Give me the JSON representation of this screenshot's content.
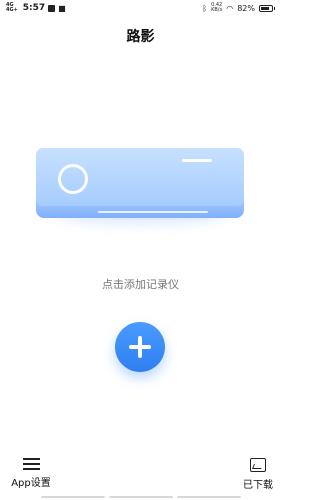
{
  "status_bar": {
    "network_top": "4G",
    "network_bottom": "4G+",
    "time": "5:57",
    "speed_value": "0.42",
    "speed_unit": "KB/s",
    "battery_percent": "82%",
    "battery_level": 0.82
  },
  "header": {
    "title": "路影"
  },
  "main": {
    "illustration_icon": "air-conditioner-icon",
    "hint": "点击添加记录仪",
    "add_button_icon": "plus-icon"
  },
  "bottom_nav": {
    "left_label": "App设置",
    "left_icon": "menu-icon",
    "right_label": "已下载",
    "right_icon": "download-gallery-icon"
  },
  "colors": {
    "accent": "#2f7ff0",
    "ac_body": "#b7d6ff",
    "hint_text": "#777777"
  }
}
